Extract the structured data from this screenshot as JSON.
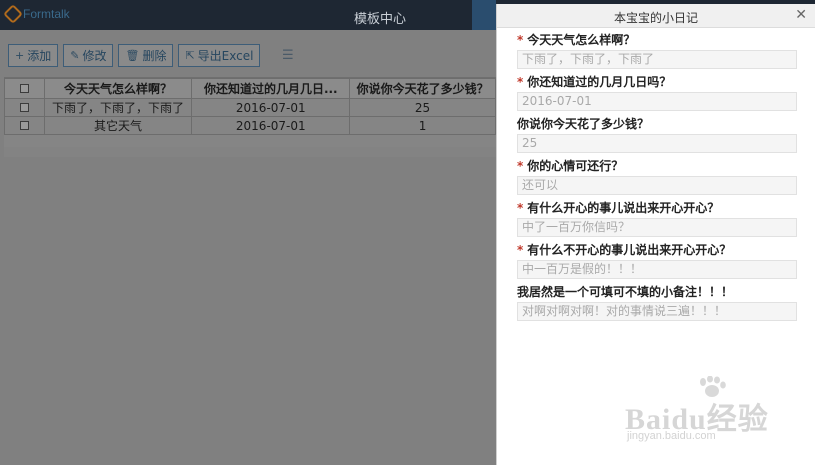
{
  "app": {
    "logo_text": "Formtalk",
    "nav_title": "模板中心"
  },
  "toolbar": {
    "add_label": "添加",
    "edit_label": "修改",
    "delete_label": "删除",
    "export_label": "导出Excel"
  },
  "grid": {
    "columns": [
      "今天天气怎么样啊？",
      "你还知道过的几月几日...",
      "你说你今天花了多少钱？"
    ],
    "rows": [
      [
        "下雨了，下雨了，下雨了",
        "2016-07-01",
        "25"
      ],
      [
        "其它天气",
        "2016-07-01",
        "1"
      ]
    ]
  },
  "dialog": {
    "title": "本宝宝的小日记",
    "fields": [
      {
        "label": "今天天气怎么样啊？",
        "required": true,
        "value": "下雨了，下雨了，下雨了"
      },
      {
        "label": "你还知道过的几月几日吗？",
        "required": true,
        "value": "2016-07-01"
      },
      {
        "label": "你说你今天花了多少钱？",
        "required": false,
        "value": "25"
      },
      {
        "label": "你的心情可还行？",
        "required": true,
        "value": "还可以"
      },
      {
        "label": "有什么开心的事儿说出来开心开心？",
        "required": true,
        "value": "中了一百万你信吗？"
      },
      {
        "label": "有什么不开心的事儿说出来开心开心？",
        "required": true,
        "value": "中一百万是假的！！！"
      },
      {
        "label": "我居然是一个可填可不填的小备注！！！",
        "required": false,
        "value": "对啊对啊对啊！对的事情说三遍！！！"
      }
    ]
  },
  "watermark": {
    "brand": "Baidu经验",
    "url": "jingyan.baidu.com"
  },
  "icons": {
    "add": "plus-icon",
    "edit": "pencil-icon",
    "delete": "trash-icon",
    "export": "export-icon",
    "list": "list-icon",
    "close": "close-icon"
  },
  "colors": {
    "topbar": "#1e2733",
    "required": "#c0392b",
    "dialog_bg": "#ffffff"
  }
}
